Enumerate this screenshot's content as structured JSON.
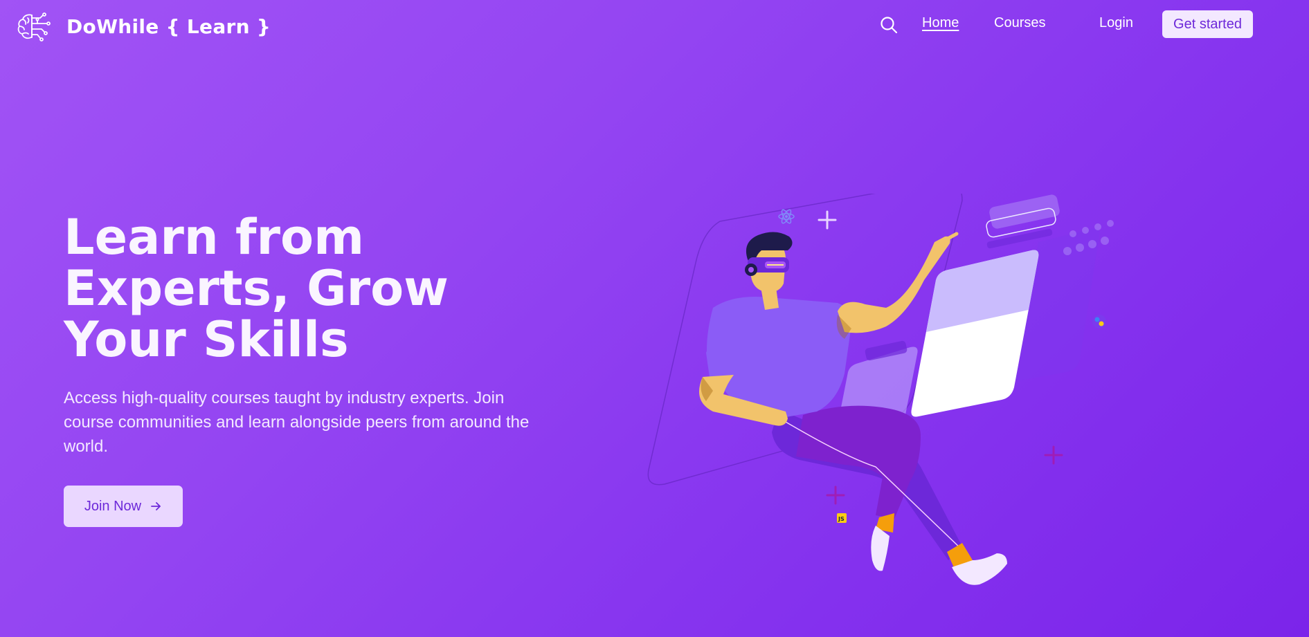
{
  "nav": {
    "brand": "DoWhile { Learn }",
    "brand_icon": "brain-circuit-icon",
    "search_icon": "search-icon",
    "links": {
      "home": "Home",
      "courses": "Courses",
      "login": "Login"
    },
    "cta": "Get started"
  },
  "hero": {
    "title": "Learn from Experts, Grow Your Skills",
    "subtitle": "Access high-quality courses taught by industry experts. Join course communities and learn alongside peers from around the world.",
    "button_label": "Join Now",
    "button_icon": "arrow-right-icon",
    "illustration_icon": "vr-learner-illustration"
  },
  "colors": {
    "background_start": "#a153f5",
    "background_end": "#7b24ea",
    "button_bg": "#f3e8ff",
    "button_text": "#6d28d9"
  }
}
